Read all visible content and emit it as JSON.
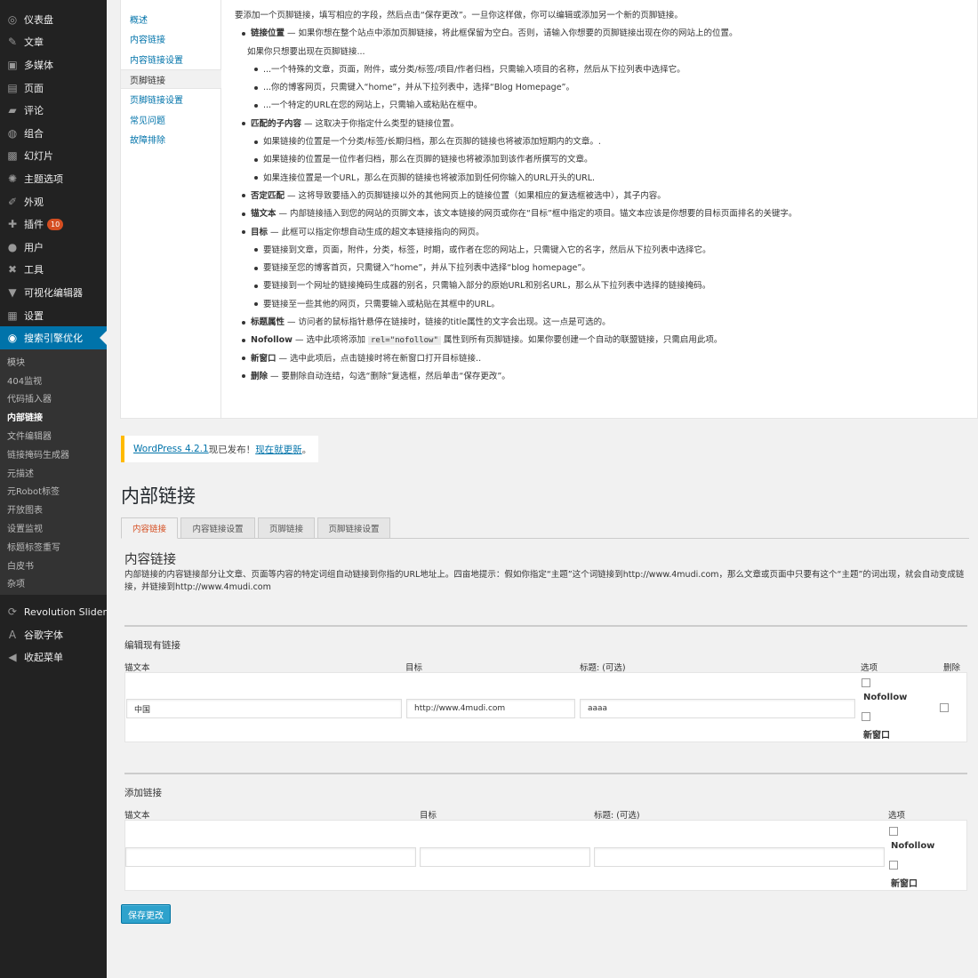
{
  "sidebar": {
    "items": [
      {
        "label": "仪表盘",
        "icon": "dashboard-icon",
        "glyph": "◎"
      },
      {
        "label": "文章",
        "icon": "pushpin-icon",
        "glyph": "✎"
      },
      {
        "label": "多媒体",
        "icon": "media-icon",
        "glyph": "▣"
      },
      {
        "label": "页面",
        "icon": "page-icon",
        "glyph": "▤"
      },
      {
        "label": "评论",
        "icon": "comment-icon",
        "glyph": "▰"
      },
      {
        "label": "组合",
        "icon": "portfolio-icon",
        "glyph": "◍"
      },
      {
        "label": "幻灯片",
        "icon": "slides-icon",
        "glyph": "▩"
      },
      {
        "label": "主题选项",
        "icon": "theme-options-icon",
        "glyph": "✺"
      },
      {
        "label": "外观",
        "icon": "appearance-icon",
        "glyph": "✐"
      },
      {
        "label": "插件",
        "icon": "plugins-icon",
        "glyph": "✚",
        "badge": "10"
      },
      {
        "label": "用户",
        "icon": "users-icon",
        "glyph": "●"
      },
      {
        "label": "工具",
        "icon": "tools-icon",
        "glyph": "✖"
      },
      {
        "label": "可视化编辑器",
        "icon": "visual-editor-icon",
        "glyph": "▼"
      },
      {
        "label": "设置",
        "icon": "settings-icon",
        "glyph": "▦"
      },
      {
        "label": "搜索引擎优化",
        "icon": "seo-icon",
        "glyph": "◉",
        "current": true
      }
    ],
    "submenu": [
      "模块",
      "404监视",
      "代码插入器",
      "内部链接",
      "文件编辑器",
      "链接掩码生成器",
      "元描述",
      "元Robot标签",
      "开放图表",
      "设置监视",
      "标题标签重写",
      "白皮书",
      "杂项"
    ],
    "submenu_current": "内部链接",
    "bottom": [
      {
        "label": "Revolution Slider",
        "icon": "refresh-icon",
        "glyph": "⟳"
      },
      {
        "label": "谷歌字体",
        "icon": "font-icon",
        "glyph": "A"
      },
      {
        "label": "收起菜单",
        "icon": "collapse-menu-icon",
        "glyph": "◀"
      }
    ]
  },
  "help": {
    "tabs": [
      "概述",
      "内容链接",
      "内容链接设置",
      "页脚链接",
      "页脚链接设置",
      "常见问题",
      "故障排除"
    ],
    "active_tab": "页脚链接",
    "intro": "要添加一个页脚链接，填写相应的字段，然后点击“保存更改”。一旦你这样做，你可以编辑或添加另一个新的页脚链接。",
    "link_position_term": "链接位置",
    "link_position_desc": " — 如果你想在整个站点中添加页脚链接，将此框保留为空白。否则，请输入你想要的页脚链接出现在你的网站上的位置。",
    "only_if": "如果你只想要出现在页脚链接...",
    "position_items": [
      "...一个特殊的文章，页面，附件，或分类/标签/项目/作者归档，只需输入项目的名称，然后从下拉列表中选择它。",
      "...你的博客网页，只需键入“home”，并从下拉列表中，选择“Blog Homepage”。",
      "...一个特定的URL在您的网站上，只需输入或粘贴在框中。"
    ],
    "matching_term": "匹配的子内容",
    "matching_desc": " — 这取决于你指定什么类型的链接位置。",
    "matching_items": [
      "如果链接的位置是一个分类/标签/长期归档，那么在页脚的链接也将被添加短期内的文章。.",
      "如果链接的位置是一位作者归档，那么在页脚的链接也将被添加到该作者所撰写的文章。",
      "如果连接位置是一个URL，那么在页脚的链接也将被添加到任何你输入的URL开头的URL."
    ],
    "negate_term": "否定匹配",
    "negate_desc": " — 这将导致要插入的页脚链接以外的其他网页上的链接位置（如果相应的复选框被选中），其子内容。",
    "anchor_term": "锚文本",
    "anchor_desc": " — 内部链接插入到您的网站的页脚文本，该文本链接的网页或你在“目标”框中指定的项目。锚文本应该是你想要的目标页面排名的关键字。",
    "target_term": "目标",
    "target_desc": " — 此框可以指定你想自动生成的超文本链接指向的网页。",
    "target_items": [
      "要链接到文章，页面，附件，分类，标签，时期，或作者在您的网站上，只需键入它的名字，然后从下拉列表中选择它。",
      "要链接至您的博客首页，只需键入“home”，并从下拉列表中选择“blog homepage”。",
      "要链接到一个网址的链接掩码生成器的别名，只需输入部分的原始URL和别名URL，那么从下拉列表中选择的链接掩码。",
      "要链接至一些其他的网页，只需要输入或粘贴在其框中的URL。"
    ],
    "title_attr_term": "标题属性",
    "title_attr_desc": " — 访问者的鼠标指针悬停在链接时，链接的title属性的文字会出现。这一点是可选的。",
    "nofollow_term": "Nofollow",
    "nofollow_desc_a": " — 选中此项将添加 ",
    "nofollow_code": "rel=\"nofollow\"",
    "nofollow_desc_b": " 属性到所有页脚链接。如果你要创建一个自动的联盟链接，只需启用此项。",
    "newwin_term": "新窗口",
    "newwin_desc": " — 选中此项后，点击链接时将在新窗口打开目标链接..",
    "delete_term": "删除",
    "delete_desc": " — 要删除自动连结，勾选“删除”复选框，然后单击“保存更改”。"
  },
  "notice": {
    "link1": "WordPress 4.2.1",
    "mid": "现已发布！",
    "link2": "现在就更新",
    "end": "。"
  },
  "page": {
    "title": "内部链接",
    "tabs": [
      "内容链接",
      "内容链接设置",
      "页脚链接",
      "页脚链接设置"
    ],
    "active_tab": "内容链接",
    "section_title": "内容链接",
    "section_desc": "内部链接的内容链接部分让文章、页面等内容的特定词组自动链接到你指的URL地址上。四亩地提示：假如你指定“主题”这个词链接到http://www.4mudi.com，那么文章或页面中只要有这个“主题”的词出现，就会自动变成链接，并链接到http://www.4mudi.com"
  },
  "edit_links": {
    "title": "编辑现有链接",
    "headers": {
      "anchor": "锚文本",
      "target": "目标",
      "title": "标题: (可选)",
      "options": "选项",
      "delete": "删除"
    },
    "row": {
      "anchor": "中国",
      "target": "http://www.4mudi.com",
      "title": "aaaa"
    },
    "opt_nofollow": "Nofollow",
    "opt_newwin": "新窗口"
  },
  "add_link": {
    "title": "添加链接",
    "headers": {
      "anchor": "锚文本",
      "target": "目标",
      "title": "标题: (可选)",
      "options": "选项"
    },
    "opt_nofollow": "Nofollow",
    "opt_newwin": "新窗口"
  },
  "save_label": "保存更改",
  "colors": {
    "accent": "#0073aa",
    "sidebar_bg": "#222222",
    "button": "#2ea2cc",
    "notice_border": "#ffba00",
    "badge": "#d54e21"
  }
}
